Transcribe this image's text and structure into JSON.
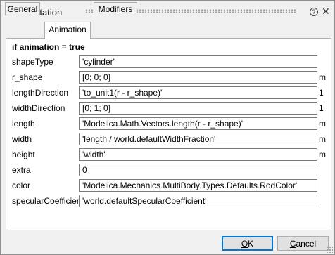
{
  "window": {
    "title": "FixedRotation"
  },
  "tabs": [
    {
      "label": "General",
      "active": false
    },
    {
      "label": "Animation",
      "active": true
    },
    {
      "label": "Modifiers",
      "active": false
    }
  ],
  "panel": {
    "heading": "if animation = true",
    "rows": [
      {
        "label": "shapeType",
        "value": "'cylinder'",
        "unit": ""
      },
      {
        "label": "r_shape",
        "value": "[0; 0; 0]",
        "unit": "m"
      },
      {
        "label": "lengthDirection",
        "value": "'to_unit1(r - r_shape)'",
        "unit": "1"
      },
      {
        "label": "widthDirection",
        "value": "[0; 1; 0]",
        "unit": "1"
      },
      {
        "label": "length",
        "value": "'Modelica.Math.Vectors.length(r - r_shape)'",
        "unit": "m"
      },
      {
        "label": "width",
        "value": "'length / world.defaultWidthFraction'",
        "unit": "m"
      },
      {
        "label": "height",
        "value": "'width'",
        "unit": "m"
      },
      {
        "label": "extra",
        "value": "0",
        "unit": ""
      },
      {
        "label": "color",
        "value": "'Modelica.Mechanics.MultiBody.Types.Defaults.RodColor'",
        "unit": ""
      },
      {
        "label": "specularCoefficient",
        "value": "'world.defaultSpecularCoefficient'",
        "unit": ""
      }
    ]
  },
  "buttons": {
    "ok_mnemonic": "O",
    "ok_rest": "K",
    "cancel_mnemonic": "C",
    "cancel_rest": "ancel"
  },
  "colors": {
    "window_bg": "#f0f0f0",
    "panel_bg": "#ffffff",
    "default_button_border": "#0078d7"
  }
}
